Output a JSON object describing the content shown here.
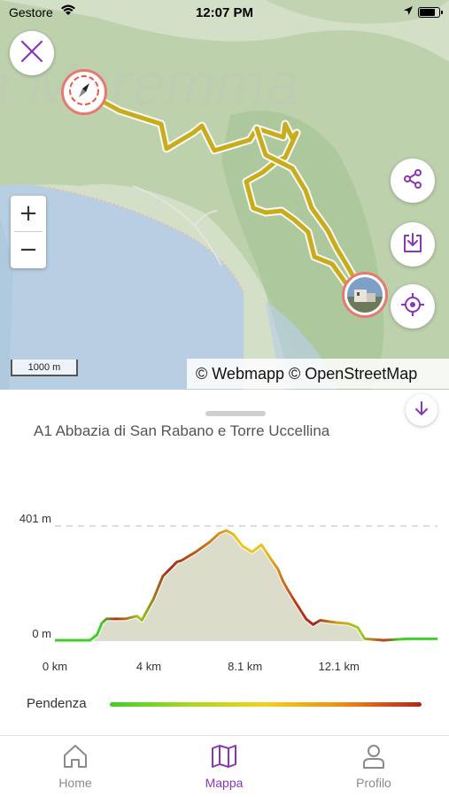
{
  "status_bar": {
    "carrier": "Gestore",
    "time": "12:07 PM",
    "battery_level": 0.85
  },
  "map": {
    "zoom_in_label": "+",
    "zoom_out_label": "−",
    "scale_label": "1000 m",
    "attribution": "© Webmapp © OpenStreetMap",
    "route_color": "#c9ac1b"
  },
  "sheet": {
    "title": "A1 Abbazia di San Rabano e Torre Uccellina",
    "legend_label": "Pendenza"
  },
  "chart_data": {
    "type": "area",
    "x_ticks": [
      "0 km",
      "4 km",
      "8.1 km",
      "12.1 km"
    ],
    "y_ticks": [
      "0 m",
      "401 m"
    ],
    "xlim": [
      0,
      16.3
    ],
    "ylim": [
      0,
      401
    ],
    "x": [
      0,
      1.5,
      1.8,
      2.0,
      2.2,
      3.0,
      3.5,
      3.7,
      4.2,
      4.6,
      4.9,
      5.0,
      5.2,
      5.4,
      6.0,
      6.6,
      7.0,
      7.3,
      7.6,
      8.0,
      8.4,
      8.8,
      9.2,
      9.5,
      9.7,
      9.9,
      10.2,
      10.7,
      11.0,
      11.3,
      12.0,
      12.5,
      12.9,
      13.2,
      14.0,
      15.0,
      16.3
    ],
    "y": [
      0,
      0,
      20,
      60,
      75,
      75,
      85,
      70,
      145,
      225,
      250,
      258,
      275,
      280,
      310,
      345,
      375,
      385,
      372,
      330,
      310,
      335,
      285,
      250,
      210,
      180,
      140,
      75,
      55,
      70,
      62,
      58,
      45,
      5,
      0,
      5,
      5
    ]
  },
  "tabs": [
    {
      "label": "Home",
      "icon": "home-icon"
    },
    {
      "label": "Mappa",
      "icon": "map-icon",
      "active": true
    },
    {
      "label": "Profilo",
      "icon": "profile-icon"
    }
  ],
  "colors": {
    "accent": "#8a36b5",
    "tab_inactive": "#8a8a8a"
  }
}
